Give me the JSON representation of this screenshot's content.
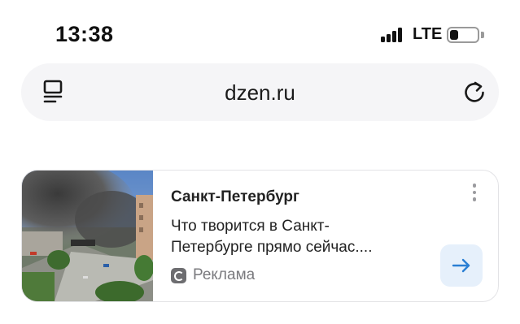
{
  "status_bar": {
    "time": "13:38",
    "network": "LTE",
    "signal_icon": "cellular-signal-icon",
    "battery_icon": "battery-low-icon",
    "battery_level": 0.3
  },
  "address_bar": {
    "url": "dzen.ru",
    "menu_icon": "tabs-menu-icon",
    "refresh_icon": "refresh-icon"
  },
  "ad_card": {
    "title": "Санкт-Петербург",
    "text_lines": [
      "Что творится в Санкт-",
      "Петербурге прямо сейчас...."
    ],
    "label": "Реклама",
    "label_icon": "ad-label-icon",
    "more_icon": "more-vertical-icon",
    "arrow_icon": "arrow-right-icon",
    "accent_color": "#2a7fd4",
    "arrow_bg_color": "#e6f0fb"
  }
}
